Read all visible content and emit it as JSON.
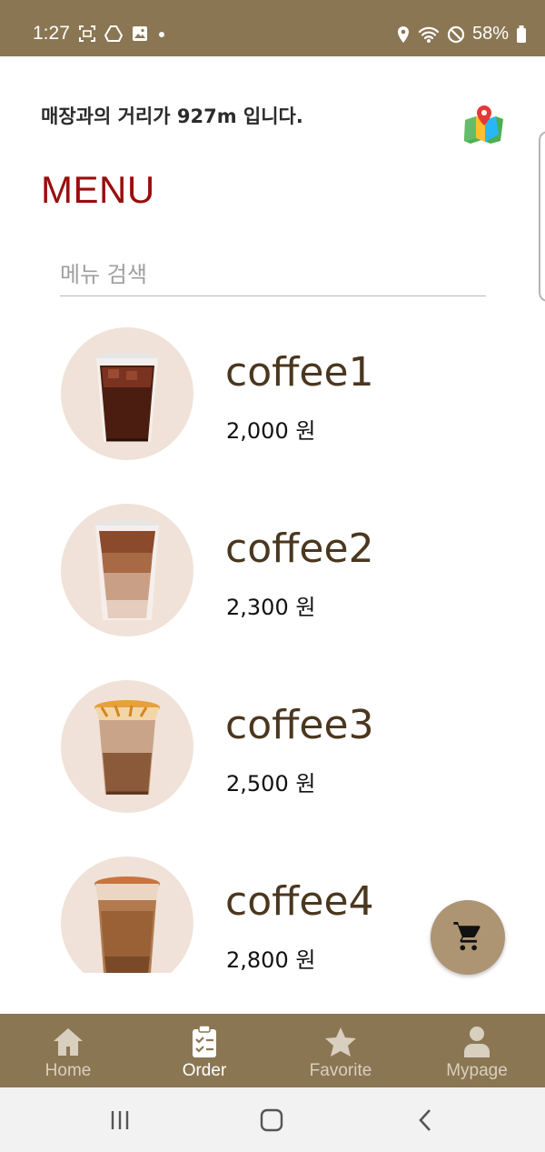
{
  "status_bar": {
    "time": "1:27",
    "battery": "58%",
    "background": "#8b7653"
  },
  "header": {
    "distance_text": "매장과의 거리가 927m 입니다.",
    "map_icon": "map-pin-icon",
    "title": "MENU",
    "title_color": "#9a0d0d"
  },
  "search": {
    "placeholder": "메뉴 검색",
    "value": ""
  },
  "menu_items": [
    {
      "name": "coffee1",
      "price": "2,000 원"
    },
    {
      "name": "coffee2",
      "price": "2,300 원"
    },
    {
      "name": "coffee3",
      "price": "2,500 원"
    },
    {
      "name": "coffee4",
      "price": "2,800 원"
    }
  ],
  "cart": {
    "icon": "shopping-cart-icon",
    "color": "#ad9473"
  },
  "bottom_nav": {
    "items": [
      {
        "label": "Home",
        "icon": "home-icon"
      },
      {
        "label": "Order",
        "icon": "clipboard-icon"
      },
      {
        "label": "Favorite",
        "icon": "star-icon"
      },
      {
        "label": "Mypage",
        "icon": "person-icon"
      }
    ],
    "active": "Order"
  },
  "system_nav": {
    "buttons": [
      "recent-apps",
      "home",
      "back"
    ]
  }
}
